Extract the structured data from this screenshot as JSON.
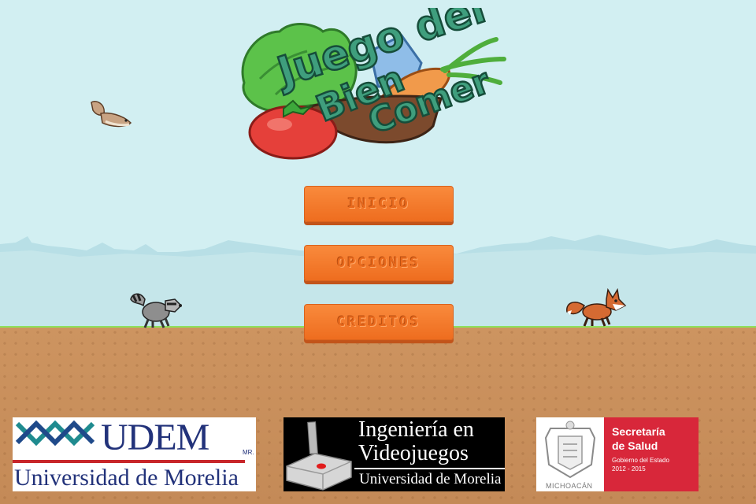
{
  "title": {
    "line1": "Juego del",
    "line2": "Bien",
    "line3": "Comer"
  },
  "menu": [
    {
      "label": "INICIO"
    },
    {
      "label": "OPCIONES"
    },
    {
      "label": "CREDITOS"
    }
  ],
  "sponsors": {
    "udem": {
      "name": "UDEM",
      "mark": "MR.",
      "subtitle": "Universidad de Morelia"
    },
    "ingenieria": {
      "line1": "Ingeniería en",
      "line2": "Videojuegos",
      "line3": "Universidad de Morelia"
    },
    "salud": {
      "line1": "Secretaría",
      "line2": "de Salud",
      "line3": "Gobierno del Estado",
      "line4": "2012 - 2015",
      "seal_label": "MICHOACÁN"
    }
  },
  "characters": [
    "squirrel",
    "raccoon",
    "fox"
  ],
  "colors": {
    "sky": "#d2eff2",
    "button": "#f47a2b",
    "grass": "#6fca3c",
    "ground": "#c88f5a",
    "salud_red": "#d8273a"
  }
}
